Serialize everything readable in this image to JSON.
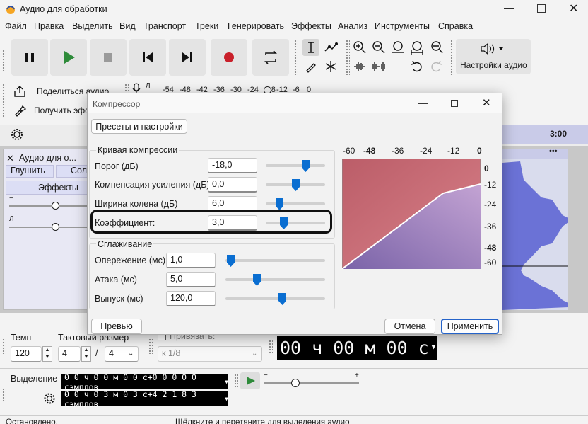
{
  "window": {
    "title": "Аудио для обработки"
  },
  "menu": [
    "Файл",
    "Правка",
    "Выделить",
    "Вид",
    "Транспорт",
    "Треки",
    "Генерировать",
    "Эффекты",
    "Анализ",
    "Инструменты",
    "Справка"
  ],
  "toolbar": {
    "audio_setup": "Настройки аудио",
    "share": "Поделиться аудио",
    "get_effects": "Получить эффекты"
  },
  "meter_ticks": [
    "-54",
    "-48",
    "-42",
    "-36",
    "-30",
    "-24",
    "-18",
    "-12",
    "-6",
    "0"
  ],
  "timeline": {
    "time_label": "3:00"
  },
  "track": {
    "name": "Аудио для о...",
    "mute": "Глушить",
    "solo": "Соло",
    "effects": "Эффекты",
    "gain_minus": "−",
    "pan_left": "Л",
    "menu_dots": "•••"
  },
  "dialog": {
    "title": "Компрессор",
    "presets": "Пресеты и настройки",
    "curve_group": "Кривая компрессии",
    "smoothing_group": "Сглаживание",
    "threshold_label": "Порог (дБ)",
    "threshold_value": "-18,0",
    "makeup_label": "Компенсация усиления (дБ)",
    "makeup_value": "0,0",
    "knee_label": "Ширина колена (дБ)",
    "knee_value": "6,0",
    "ratio_label": "Коэффициент:",
    "ratio_value": "3,0",
    "lookahead_label": "Опережение (мс)",
    "lookahead_value": "1,0",
    "attack_label": "Атака (мс)",
    "attack_value": "5,0",
    "release_label": "Выпуск (мс)",
    "release_value": "120,0",
    "preview": "Превью",
    "cancel": "Отмена",
    "apply": "Применить",
    "graph_x_ticks": [
      "-60",
      "-48",
      "-36",
      "-24",
      "-12",
      "0"
    ],
    "graph_y_ticks": [
      "0",
      "-12",
      "-24",
      "-36",
      "-48",
      "-60"
    ]
  },
  "bottom": {
    "tempo_label": "Темп",
    "tempo_value": "120",
    "time_sig_label": "Тактовый размер",
    "time_sig_num": "4",
    "time_sig_sep": "/",
    "time_sig_den": "4",
    "snap_label": "Привязать:",
    "snap_value": "к 1/8",
    "big_time": "00 ч 00 м 00 с",
    "selection_label": "Выделение",
    "sel_start": "0 0 ч 0 0 м 0 0 с+0 0 0 0 0 сэмплов",
    "sel_end": "0 0 ч 0 3 м 0 3 с+4 2 1 8 3 сэмплов",
    "play_slider_minus": "−",
    "play_slider_plus": "+"
  },
  "status": {
    "left": "Остановлено.",
    "right": "Щёлкните и перетяните для выделения аудио"
  }
}
